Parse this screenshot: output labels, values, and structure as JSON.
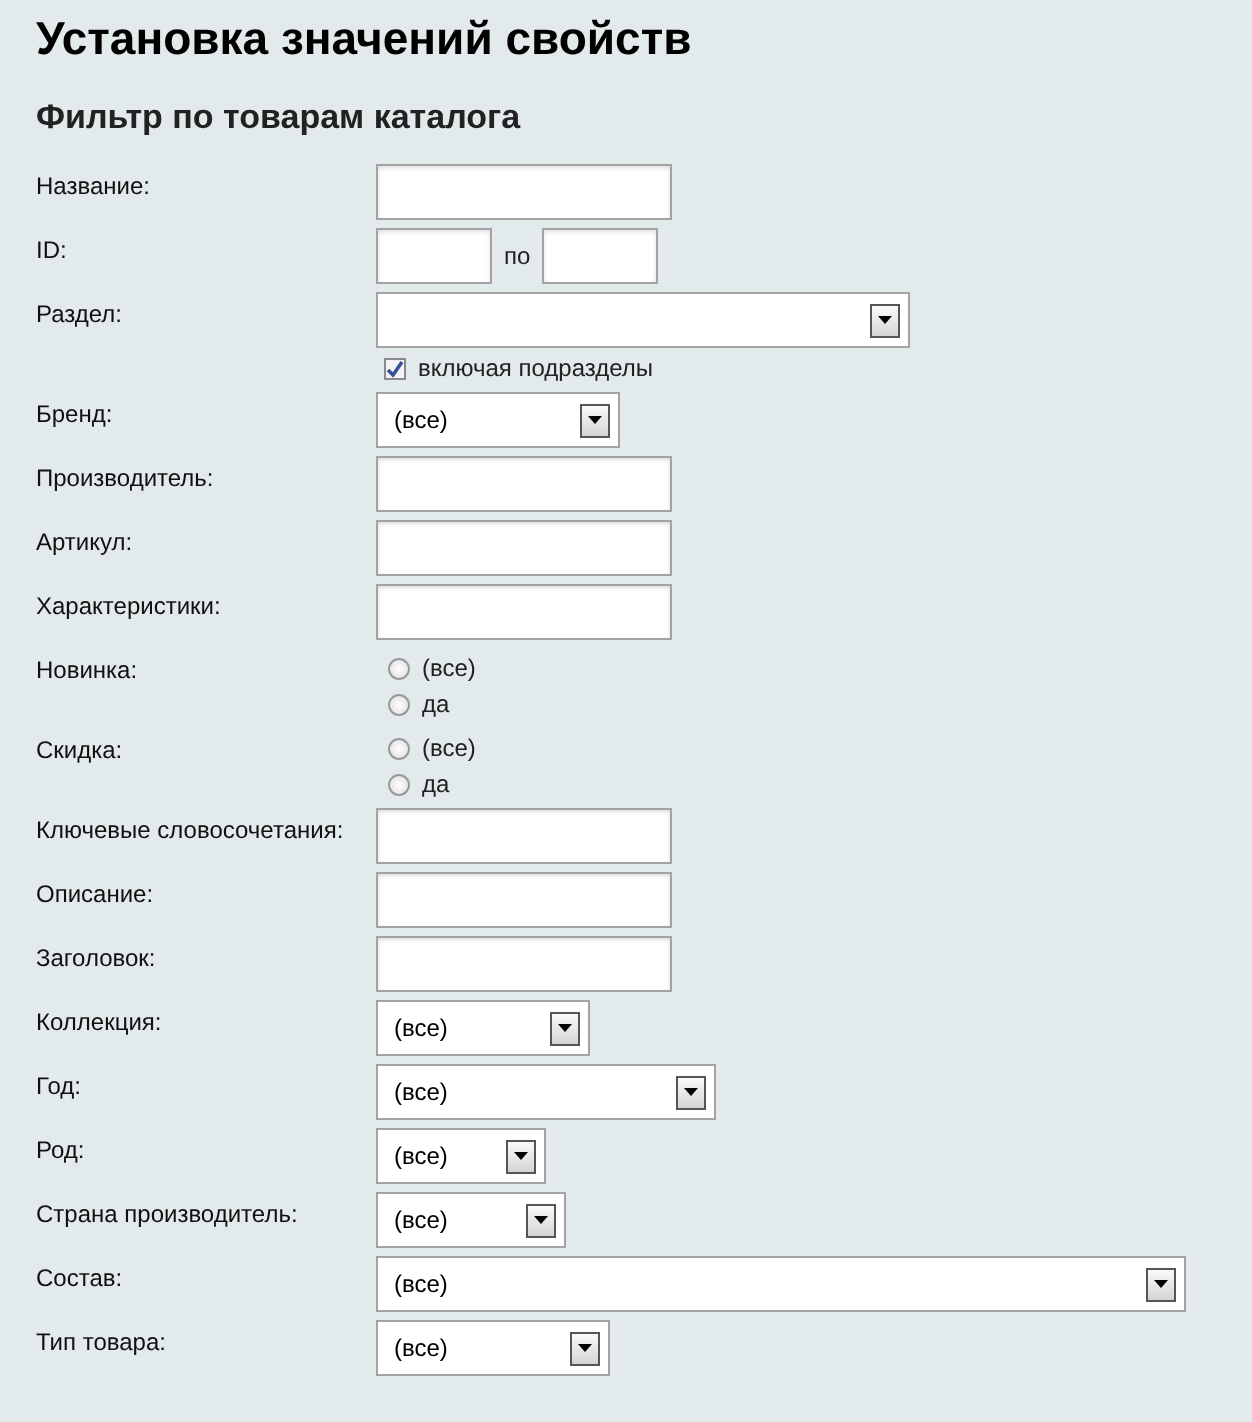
{
  "title": "Установка значений свойств",
  "subtitle": "Фильтр по товарам каталога",
  "fields": [
    {
      "label": "Название:",
      "kind": "text"
    },
    {
      "label": "ID:",
      "kind": "range",
      "separator": "по"
    },
    {
      "label": "Раздел:",
      "kind": "select",
      "checkbox": {
        "label": "включая подразделы",
        "checked": true
      }
    },
    {
      "label": "Бренд:",
      "kind": "select",
      "value": "(все)"
    },
    {
      "label": "Производитель:",
      "kind": "text"
    },
    {
      "label": "Артикул:",
      "kind": "text"
    },
    {
      "label": "Характеристики:",
      "kind": "text"
    },
    {
      "label": "Новинка:",
      "kind": "radio",
      "options": [
        {
          "label": "(все)",
          "selected": false
        },
        {
          "label": "да",
          "selected": false
        }
      ]
    },
    {
      "label": "Скидка:",
      "kind": "radio",
      "options": [
        {
          "label": "(все)",
          "selected": false
        },
        {
          "label": "да",
          "selected": false
        }
      ]
    },
    {
      "label": "Ключевые словосочетания:",
      "kind": "text"
    },
    {
      "label": "Описание:",
      "kind": "text"
    },
    {
      "label": "Заголовок:",
      "kind": "text"
    },
    {
      "label": "Коллекция:",
      "kind": "select",
      "value": "(все)"
    },
    {
      "label": "Год:",
      "kind": "select",
      "value": "(все)"
    },
    {
      "label": "Род:",
      "kind": "select",
      "value": "(все)"
    },
    {
      "label": "Страна производитель:",
      "kind": "select",
      "value": "(все)"
    },
    {
      "label": "Состав:",
      "kind": "select",
      "value": "(все)"
    },
    {
      "label": "Тип товара:",
      "kind": "select",
      "value": "(все)"
    }
  ]
}
